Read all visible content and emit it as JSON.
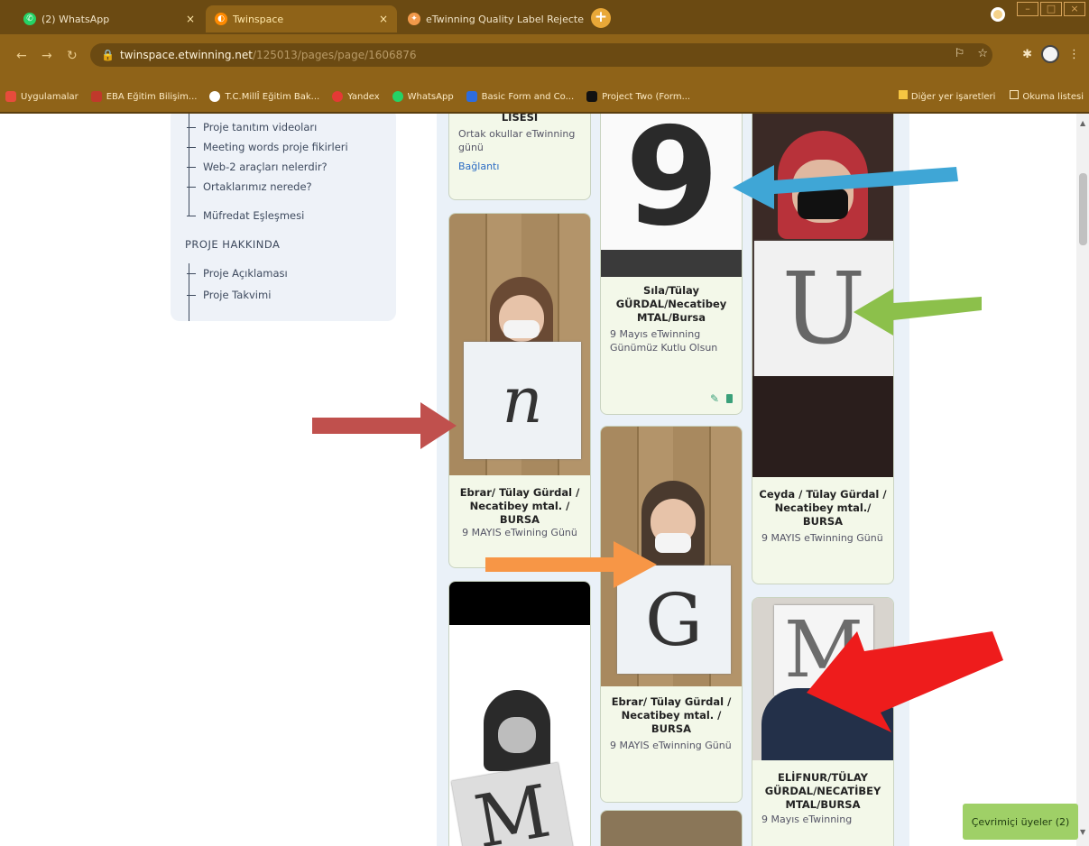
{
  "browser": {
    "tabs": [
      {
        "title": "(2) WhatsApp",
        "close": "×"
      },
      {
        "title": "Twinspace",
        "close": "×"
      },
      {
        "title": "eTwinning Quality Label Rejecte",
        "close": "×"
      }
    ],
    "new_tab": "+",
    "url_host": "twinspace.etwinning.net",
    "url_path": "/125013/pages/page/1606876",
    "bookmarks": [
      {
        "label": "Uygulamalar",
        "color": "#e74c3c"
      },
      {
        "label": "EBA Eğitim Bilişim...",
        "color": "#c0392b"
      },
      {
        "label": "T.C.MillÎ Eğitim Bak...",
        "color": "#d35454"
      },
      {
        "label": "Yandex",
        "color": "#e53935"
      },
      {
        "label": "WhatsApp",
        "color": "#25d366"
      },
      {
        "label": "Basic Form and Co...",
        "color": "#2d6cdf"
      },
      {
        "label": "Project Two (Form...",
        "color": "#111111"
      }
    ],
    "bookmarks_right": [
      "Diğer yer işaretleri",
      "Okuma listesi"
    ]
  },
  "sidebar": {
    "items_top": [
      "Proje tanıtım videoları",
      "Meeting words proje fikirleri",
      "Web-2 araçları nelerdir?",
      "Ortaklarımız nerede?",
      "Müfredat Eşleşmesi"
    ],
    "section_heading": "PROJE HAKKINDA",
    "items_bottom": [
      "Proje Açıklaması",
      "Proje Takvimi"
    ]
  },
  "cards": {
    "lisesi": {
      "title": "LİSESİ",
      "text": "Ortak okullar eTwinning günü",
      "link": "Bağlantı"
    },
    "ebrar1": {
      "title": "Ebrar/ Tülay Gürdal / Necatibey mtal. / BURSA",
      "text": "9 MAYIS eTwining Günü",
      "letter": "n"
    },
    "sila": {
      "title": "Sıla/Tülay GÜRDAL/Necatibey MTAL/Bursa",
      "text": "9 Mayıs eTwinning Günümüz Kutlu Olsun",
      "letter": "9"
    },
    "ebrar2": {
      "title": "Ebrar/ Tülay Gürdal / Necatibey mtal. / BURSA",
      "text": "9 MAYIS eTwinning Günü",
      "letter": "G"
    },
    "ceyda": {
      "title": "Ceyda / Tülay Gürdal / Necatibey mtal./ BURSA",
      "text": "9 MAYIS eTwinning Günü",
      "letter": "U"
    },
    "elifnur": {
      "title": "ELİFNUR/TÜLAY GÜRDAL/NECATİBEY MTAL/BURSA",
      "text": "9 Mayıs eTwinning",
      "letter": "M"
    },
    "bw": {
      "letter": "M"
    }
  },
  "online_members": "Çevrimiçi üyeler (2)",
  "colors": {
    "arrow_blue": "#3fa6d6",
    "arrow_green": "#8cc04b",
    "arrow_brown": "#c0504d",
    "arrow_orange": "#f79646",
    "arrow_red": "#ee1c1c"
  }
}
